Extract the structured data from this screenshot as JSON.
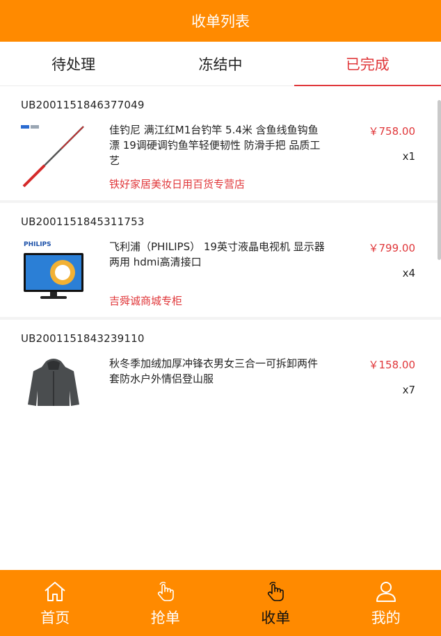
{
  "header": {
    "title": "收单列表"
  },
  "tabs": [
    {
      "label": "待处理"
    },
    {
      "label": "冻结中"
    },
    {
      "label": "已完成"
    }
  ],
  "orders": [
    {
      "id": "UB2001151846377049",
      "title": "佳钓尼 满江红M1台钓竿 5.4米 含鱼线鱼钩鱼漂 19调硬调钓鱼竿轻便韧性 防滑手把 品质工艺",
      "shop": "铁好家居美妆日用百货专营店",
      "price": "￥758.00",
      "qty": "x1",
      "thumb_icon": "fishing-rod-image"
    },
    {
      "id": "UB2001151845311753",
      "title": "飞利浦（PHILIPS） 19英寸液晶电视机 显示器两用 hdmi高清接口",
      "shop": "吉舜诚商城专柜",
      "price": "￥799.00",
      "qty": "x4",
      "thumb_icon": "tv-image",
      "thumb_brand": "PHILIPS"
    },
    {
      "id": "UB2001151843239110",
      "title": "秋冬季加绒加厚冲锋衣男女三合一可拆卸两件套防水户外情侣登山服",
      "shop": "",
      "price": "￥158.00",
      "qty": "x7",
      "thumb_icon": "jacket-image"
    }
  ],
  "bottom_nav": [
    {
      "label": "首页",
      "icon": "home-icon"
    },
    {
      "label": "抢单",
      "icon": "tap-hand-icon"
    },
    {
      "label": "收单",
      "icon": "tap-hand-icon"
    },
    {
      "label": "我的",
      "icon": "user-icon"
    }
  ],
  "colors": {
    "brand": "#ff8a00",
    "accent": "#e0373a"
  }
}
